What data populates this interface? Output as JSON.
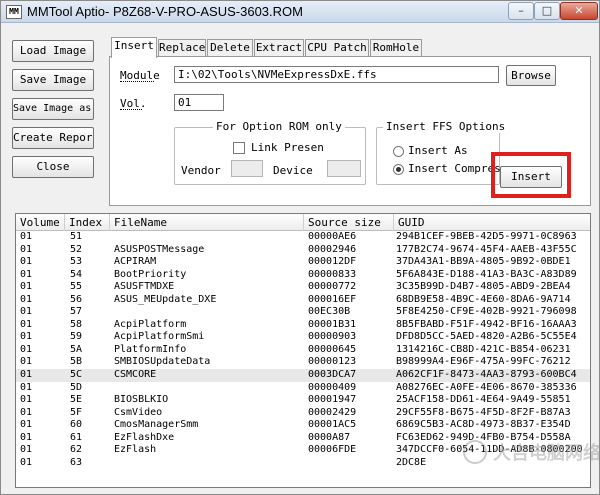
{
  "window": {
    "title": "MMTool Aptio- P8Z68-V-PRO-ASUS-3603.ROM",
    "icon_text": "MM",
    "minimize": "–",
    "maximize": "□",
    "close": "✕"
  },
  "side_buttons": {
    "load_image": "Load Image",
    "save_image": "Save Image",
    "save_image_as": "Save Image as..",
    "create_report": "Create Report",
    "close": "Close"
  },
  "tabs": [
    "Insert",
    "Replace",
    "Delete",
    "Extract",
    "CPU Patch",
    "RomHole"
  ],
  "insert_panel": {
    "module_label": "Module",
    "module_value": "I:\\02\\Tools\\NVMeExpressDxE.ffs",
    "browse_label": "Browse",
    "vol_label": "Vol.",
    "vol_value": "01",
    "option_rom_title": "For Option ROM only",
    "link_present_label": "Link Presen",
    "link_present_checked": false,
    "vendor_label": "Vendor",
    "vendor_value": "",
    "device_label": "Device",
    "device_value": "",
    "ffs_options_title": "Insert FFS Options",
    "insert_as_label": "Insert As",
    "insert_compress_label": "Insert Compress",
    "selected_option": "Insert Compress",
    "insert_button": "Insert",
    "highlight_color": "#e0201c"
  },
  "table": {
    "columns": [
      "Volume",
      "Index",
      "FileName",
      "Source size",
      "GUID"
    ],
    "rows": [
      [
        "01",
        "51",
        "",
        "00000AE6",
        "294B1CEF-9BEB-42D5-9971-0C8963"
      ],
      [
        "01",
        "52",
        "ASUSPOSTMessage",
        "00002946",
        "177B2C74-9674-45F4-AAEB-43F55C"
      ],
      [
        "01",
        "53",
        "ACPIRAM",
        "000012DF",
        "37DA43A1-BB9A-4805-9B92-0BDE1"
      ],
      [
        "01",
        "54",
        "BootPriority",
        "00000833",
        "5F6A843E-D188-41A3-BA3C-A83D89"
      ],
      [
        "01",
        "55",
        "ASUSFTMDXE",
        "00000772",
        "3C35B99D-D4B7-4805-ABD9-2BEA4"
      ],
      [
        "01",
        "56",
        "ASUS_MEUpdate_DXE",
        "000016EF",
        "68DB9E58-4B9C-4E60-8DA6-9A714"
      ],
      [
        "01",
        "57",
        "",
        "00EC30B",
        "5F8E4250-CF9E-402B-9921-796098"
      ],
      [
        "01",
        "58",
        "AcpiPlatform",
        "00001B31",
        "8B5FBABD-F51F-4942-BF16-16AAA3"
      ],
      [
        "01",
        "59",
        "AcpiPlatformSmi",
        "00000903",
        "DFD8D5CC-5AED-4820-A2B6-5C55E4"
      ],
      [
        "01",
        "5A",
        "PlatformInfo",
        "00000645",
        "1314216C-CB8D-421C-B854-06231"
      ],
      [
        "01",
        "5B",
        "SMBIOSUpdateData",
        "00000123",
        "B98999A4-E96F-475A-99FC-76212"
      ],
      [
        "01",
        "5C",
        "CSMCORE",
        "0003DCA7",
        "A062CF1F-8473-4AA3-8793-600BC4"
      ],
      [
        "01",
        "5D",
        "",
        "00000409",
        "A08276EC-A0FE-4E06-8670-385336"
      ],
      [
        "01",
        "5E",
        "BIOSBLKIO",
        "00001947",
        "25ACF158-DD61-4E64-9A49-55851"
      ],
      [
        "01",
        "5F",
        "CsmVideo",
        "00002429",
        "29CF55F8-B675-4F5D-8F2F-B87A3"
      ],
      [
        "01",
        "60",
        "CmosManagerSmm",
        "00001AC5",
        "6869C5B3-AC8D-4973-8B37-E354D"
      ],
      [
        "01",
        "61",
        "EzFlashDxe",
        "0000A87",
        "FC63ED62-949D-4FB0-B754-D558A"
      ],
      [
        "01",
        "62",
        "EzFlash",
        "00006FDE",
        "347DCCF0-6054-11DD-AD8B-0800200"
      ],
      [
        "01",
        "63",
        "",
        "",
        "2DC8E"
      ]
    ],
    "selected_row_index": 11
  },
  "watermark": "大吉电脑网络"
}
